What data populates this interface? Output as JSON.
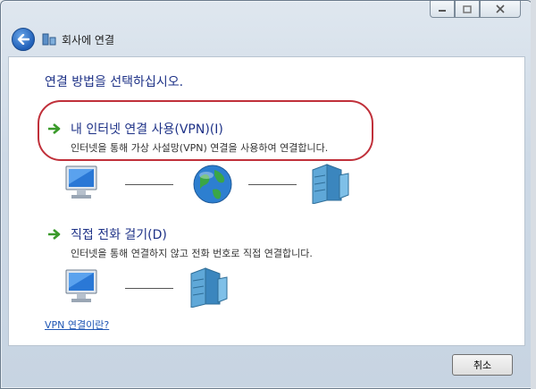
{
  "window": {
    "title": "회사에 연결",
    "caption_buttons": [
      "minimize",
      "maximize",
      "close"
    ]
  },
  "main": {
    "heading": "연결 방법을 선택하십시오.",
    "options": [
      {
        "title": "내 인터넷 연결 사용(VPN)(I)",
        "description": "인터넷을 통해 가상 사설망(VPN) 연결을 사용하여 연결합니다."
      },
      {
        "title": "직접 전화 걸기(D)",
        "description": "인터넷을 통해 연결하지 않고 전화 번호로 직접 연결합니다."
      }
    ],
    "help_link": "VPN 연결이란?"
  },
  "footer": {
    "cancel_label": "취소"
  },
  "colors": {
    "heading": "#1e3287",
    "highlight": "#c0303a",
    "link": "#1f56b4"
  },
  "icons": [
    "back-arrow-icon",
    "network-icon",
    "computer-icon",
    "globe-icon",
    "server-icon",
    "green-arrow-icon"
  ]
}
